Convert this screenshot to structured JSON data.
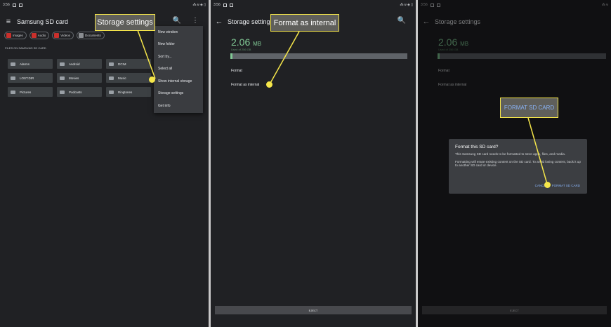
{
  "panel1": {
    "status": {
      "time": "3:56",
      "right": "⁂ ᵾ ◈ ▯"
    },
    "appbar": {
      "menu_icon": "≡",
      "title": "Samsung SD card",
      "trail": "🔍 ⋮"
    },
    "chips": [
      {
        "label": "Images"
      },
      {
        "label": "Audio"
      },
      {
        "label": "Videos"
      },
      {
        "label": "Documents"
      }
    ],
    "section_label": "FILES ON SAMSUNG SD CARD",
    "folders": [
      "Alarms",
      "Android",
      "DCIM",
      "LOST.DIR",
      "Movies",
      "Music",
      "Pictures",
      "Podcasts",
      "Ringtones"
    ],
    "menu": [
      "New window",
      "New folder",
      "Sort by...",
      "Select all",
      "Show internal storage",
      "Storage settings",
      "Get info"
    ],
    "callout": "Storage settings"
  },
  "panel2": {
    "status": {
      "time": "3:56",
      "right": "⁂ ᵾ ◈ ▯"
    },
    "appbar": {
      "back_icon": "←",
      "title": "Storage settings",
      "trail": "🔍"
    },
    "size_value": "2.06",
    "size_unit": "MB",
    "size_sub": "Used of 256 GB",
    "storage_used_fraction": 0.01,
    "items": [
      "Format",
      "Format as internal"
    ],
    "eject": "EJECT",
    "callout": "Format as internal"
  },
  "panel3": {
    "status": {
      "time": "3:56",
      "right": "⁂ ᵾ"
    },
    "appbar": {
      "back_icon": "←",
      "title": "Storage settings"
    },
    "size_value": "2.06",
    "size_unit": "MB",
    "size_sub": "Used of 256 GB",
    "items": [
      "Format",
      "Format as internal"
    ],
    "eject": "EJECT",
    "dialog": {
      "title": "Format this SD card?",
      "body1": "This Samsung SD card needs to be formatted to store apps, files, and media.",
      "body2": "Formatting will erase existing content on the SD card. To avoid losing content, back it up to another SD card or device.",
      "cancel": "CANCEL",
      "confirm": "FORMAT SD CARD"
    },
    "callout": "FORMAT SD CARD"
  },
  "colors": {
    "callout_border": "#f5e64a",
    "accent_green": "#81c995",
    "accent_blue": "#8ab4f8"
  }
}
